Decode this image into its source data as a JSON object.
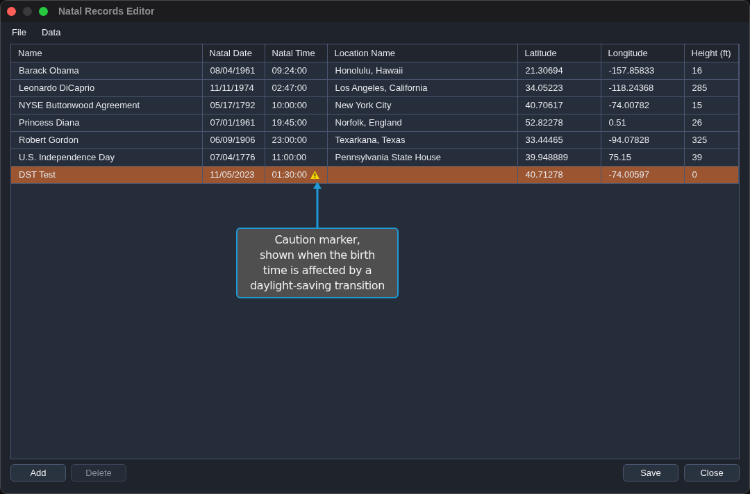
{
  "window": {
    "title": "Natal Records Editor",
    "controls": [
      {
        "kind": "close",
        "disabled": false
      },
      {
        "kind": "minimize",
        "disabled": true
      },
      {
        "kind": "zoom",
        "disabled": false
      }
    ]
  },
  "menu": [
    "File",
    "Data"
  ],
  "table": {
    "columns": [
      "Name",
      "Natal Date",
      "Natal Time",
      "Location Name",
      "Latitude",
      "Longitude",
      "Height (ft)"
    ],
    "rows": [
      {
        "name": "Barack Obama",
        "natal_date": "08/04/1961",
        "natal_time": "09:24:00",
        "location_name": "Honolulu, Hawaii",
        "latitude": "21.30694",
        "longitude": "-157.85833",
        "height_ft": "16",
        "selected": false,
        "dst_warning": false
      },
      {
        "name": "Leonardo DiCaprio",
        "natal_date": "11/11/1974",
        "natal_time": "02:47:00",
        "location_name": "Los Angeles, California",
        "latitude": "34.05223",
        "longitude": "-118.24368",
        "height_ft": "285",
        "selected": false,
        "dst_warning": false
      },
      {
        "name": "NYSE Buttonwood Agreement",
        "natal_date": "05/17/1792",
        "natal_time": "10:00:00",
        "location_name": "New York City",
        "latitude": "40.70617",
        "longitude": "-74.00782",
        "height_ft": "15",
        "selected": false,
        "dst_warning": false
      },
      {
        "name": "Princess Diana",
        "natal_date": "07/01/1961",
        "natal_time": "19:45:00",
        "location_name": "Norfolk, England",
        "latitude": "52.82278",
        "longitude": "0.51",
        "height_ft": "26",
        "selected": false,
        "dst_warning": false
      },
      {
        "name": "Robert Gordon",
        "natal_date": "06/09/1906",
        "natal_time": "23:00:00",
        "location_name": "Texarkana, Texas",
        "latitude": "33.44465",
        "longitude": "-94.07828",
        "height_ft": "325",
        "selected": false,
        "dst_warning": false
      },
      {
        "name": "U.S. Independence Day",
        "natal_date": "07/04/1776",
        "natal_time": "11:00:00",
        "location_name": "Pennsylvania State House",
        "latitude": "39.948889",
        "longitude": "75.15",
        "height_ft": "39",
        "selected": false,
        "dst_warning": false
      },
      {
        "name": "DST Test",
        "natal_date": "11/05/2023",
        "natal_time": "01:30:00",
        "latitude": "40.71278",
        "longitude": "-74.00597",
        "height_ft": "0",
        "selected": true,
        "dst_warning": true
      }
    ]
  },
  "annotation": {
    "text": "Caution marker,\nshown when the birth\ntime is affected by a\ndaylight-saving transition"
  },
  "buttons_left": [
    {
      "label": "Add",
      "disabled": false
    },
    {
      "label": "Delete",
      "disabled": true
    }
  ],
  "buttons_right": [
    {
      "label": "Save",
      "disabled": false
    },
    {
      "label": "Close",
      "disabled": false
    }
  ]
}
